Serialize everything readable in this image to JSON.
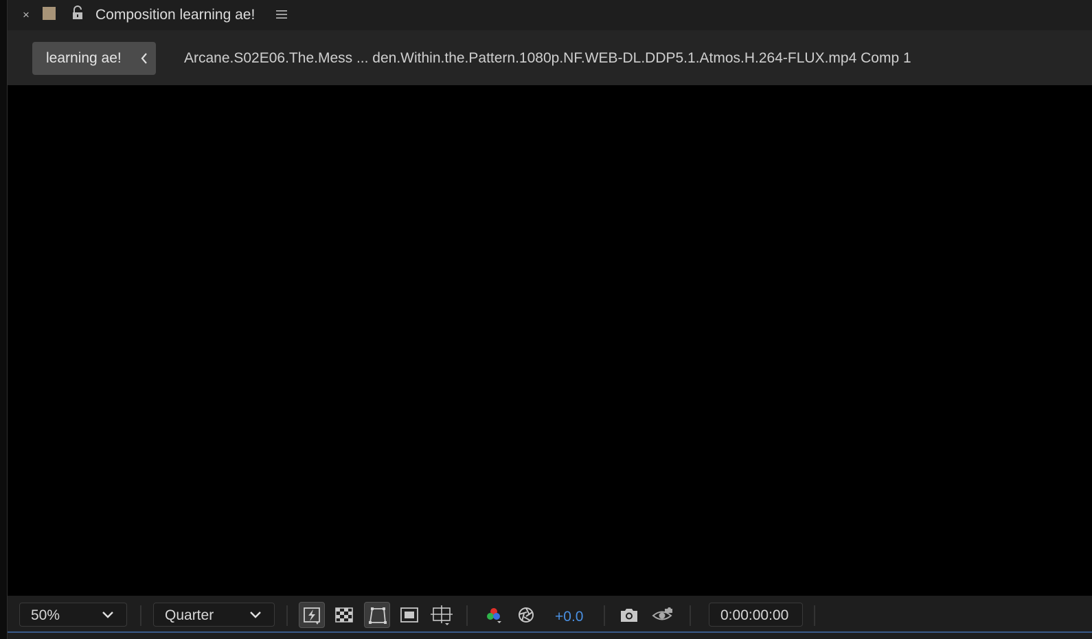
{
  "panel": {
    "title": "Composition learning ae!",
    "close_glyph": "×",
    "label_color": "#a89478",
    "icons": [
      "close-icon",
      "composition-color-swatch",
      "lock-icon",
      "panel-menu-icon"
    ]
  },
  "breadcrumb": {
    "current": "learning ae!",
    "path": "Arcane.S02E06.The.Mess ... den.Within.the.Pattern.1080p.NF.WEB-DL.DDP5.1.Atmos.H.264-FLUX.mp4 Comp 1"
  },
  "toolbar": {
    "magnification": "50%",
    "resolution": "Quarter",
    "exposure": "+0.0",
    "timecode": "0:00:00:00",
    "accent_color": "#4a90e2",
    "icons": [
      "fast-previews-icon",
      "transparency-grid-icon",
      "mask-path-visibility-icon",
      "region-of-interest-icon",
      "grid-guides-icon",
      "show-channel-icon",
      "reset-exposure-icon",
      "snapshot-icon",
      "show-snapshot-icon"
    ]
  }
}
